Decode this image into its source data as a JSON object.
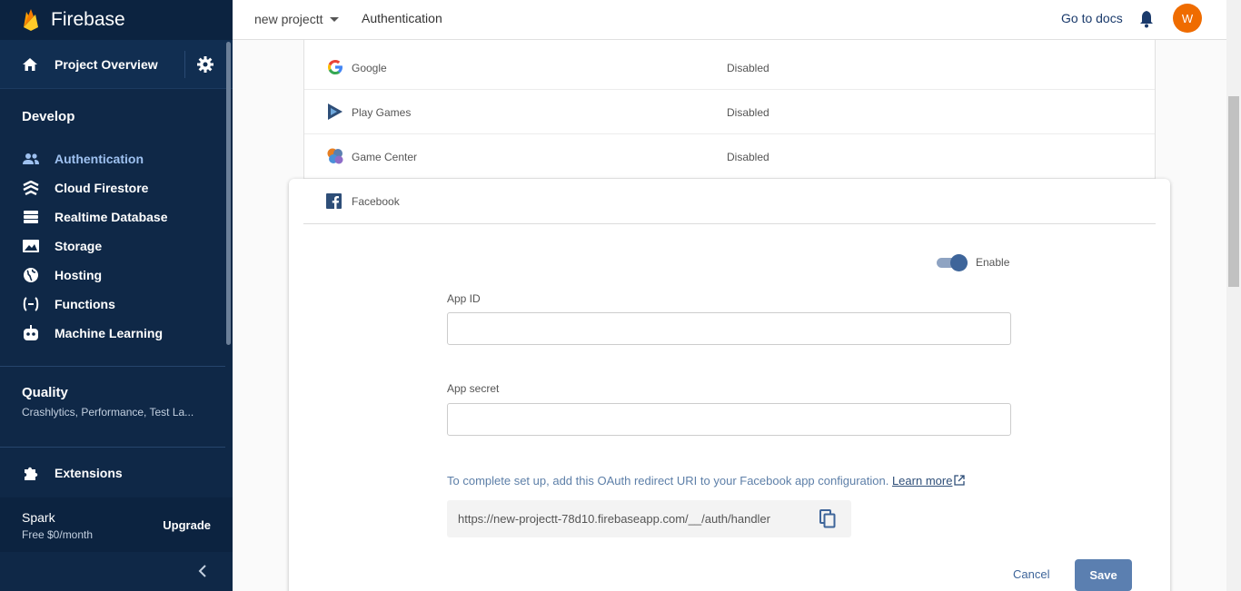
{
  "sidebar": {
    "brand": "Firebase",
    "overview_label": "Project Overview",
    "develop_heading": "Develop",
    "items": [
      {
        "label": "Authentication",
        "icon": "people-icon"
      },
      {
        "label": "Cloud Firestore",
        "icon": "firestore-icon"
      },
      {
        "label": "Realtime Database",
        "icon": "database-icon"
      },
      {
        "label": "Storage",
        "icon": "image-icon"
      },
      {
        "label": "Hosting",
        "icon": "globe-icon"
      },
      {
        "label": "Functions",
        "icon": "functions-icon"
      },
      {
        "label": "Machine Learning",
        "icon": "robot-icon"
      }
    ],
    "quality_heading": "Quality",
    "quality_sub": "Crashlytics, Performance, Test La...",
    "extensions_label": "Extensions",
    "plan_name": "Spark",
    "plan_price": "Free $0/month",
    "upgrade_label": "Upgrade"
  },
  "topbar": {
    "project": "new projectt",
    "breadcrumb": "Authentication",
    "docs_label": "Go to docs",
    "avatar_initial": "W"
  },
  "providers": [
    {
      "name": "Google",
      "status": "Disabled"
    },
    {
      "name": "Play Games",
      "status": "Disabled"
    },
    {
      "name": "Game Center",
      "status": "Disabled"
    }
  ],
  "facebook": {
    "name": "Facebook",
    "enable_label": "Enable",
    "enabled": true,
    "app_id_label": "App ID",
    "app_id_value": "",
    "app_secret_label": "App secret",
    "app_secret_value": "",
    "info_text": "To complete set up, add this OAuth redirect URI to your Facebook app configuration.",
    "learn_more": "Learn more",
    "redirect_uri": "https://new-projectt-78d10.firebaseapp.com/__/auth/handler",
    "cancel_label": "Cancel",
    "save_label": "Save"
  },
  "colors": {
    "sidebar_bg": "#0f2847",
    "active_item": "#9ec1f0",
    "avatar_bg": "#ef6c00",
    "primary_button": "#5b7fb0"
  }
}
